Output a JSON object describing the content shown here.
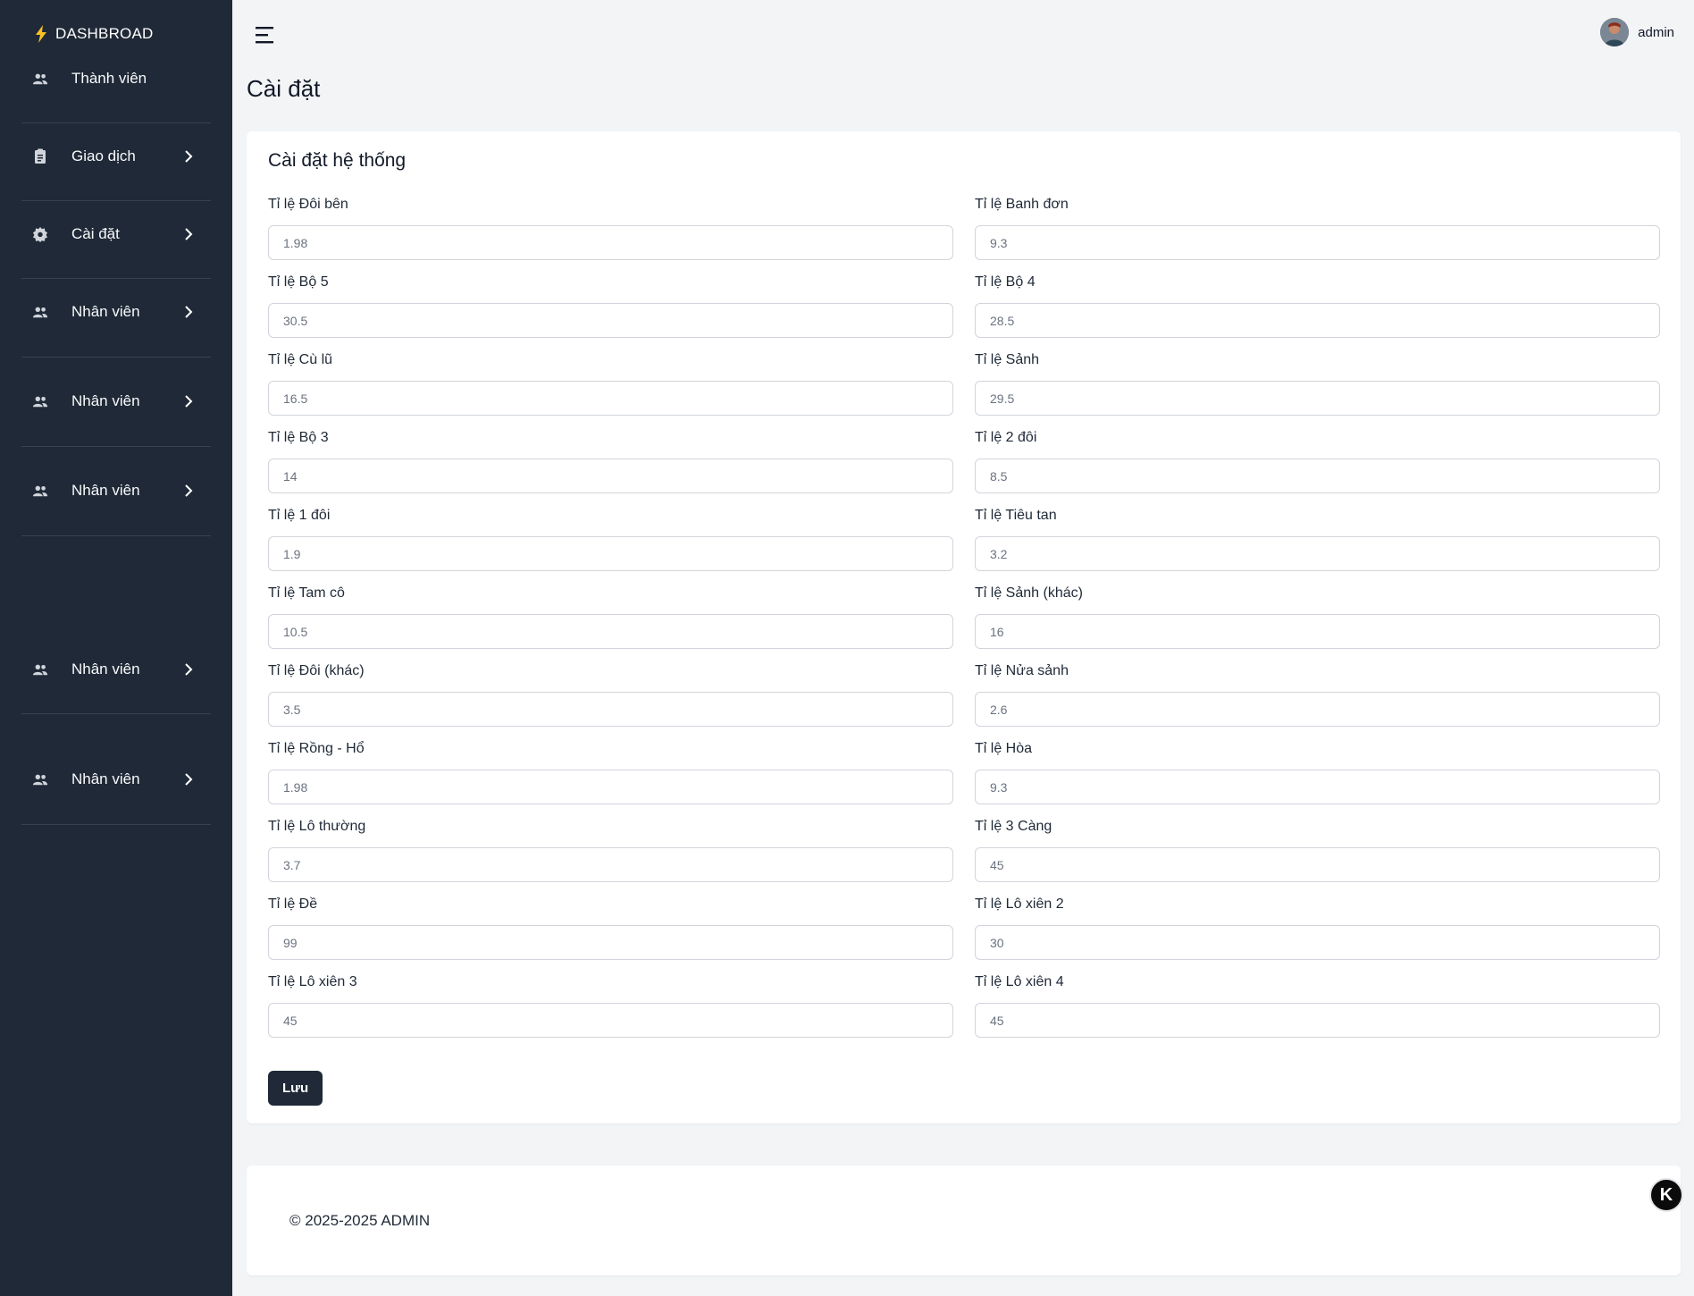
{
  "sidebar": {
    "brand": "DASHBROAD",
    "items": [
      {
        "label": "Thành viên",
        "icon": "users-icon",
        "chevron": false
      },
      {
        "label": "Giao dịch",
        "icon": "clipboard-icon",
        "chevron": true
      },
      {
        "label": "Cài đặt",
        "icon": "gear-icon",
        "chevron": true
      },
      {
        "label": "Nhân viên",
        "icon": "users-icon",
        "chevron": true
      },
      {
        "label": "Nhân viên",
        "icon": "users-icon",
        "chevron": true
      },
      {
        "label": "Nhân viên",
        "icon": "users-icon",
        "chevron": true
      },
      {
        "label": "Nhân viên",
        "icon": "users-icon",
        "chevron": true
      },
      {
        "label": "Nhân viên",
        "icon": "users-icon",
        "chevron": true
      }
    ]
  },
  "header": {
    "user_name": "admin"
  },
  "page_title": "Cài đặt",
  "form": {
    "title": "Cài đặt hệ thống",
    "fields": [
      {
        "label": "Tỉ lệ Đôi bên",
        "value": "1.98"
      },
      {
        "label": "Tỉ lệ Banh đơn",
        "value": "9.3"
      },
      {
        "label": "Tỉ lệ Bộ 5",
        "value": "30.5"
      },
      {
        "label": "Tỉ lệ Bộ 4",
        "value": "28.5"
      },
      {
        "label": "Tỉ lệ Cù lũ",
        "value": "16.5"
      },
      {
        "label": "Tỉ lệ Sảnh",
        "value": "29.5"
      },
      {
        "label": "Tỉ lệ Bộ 3",
        "value": "14"
      },
      {
        "label": "Tỉ lệ 2 đôi",
        "value": "8.5"
      },
      {
        "label": "Tỉ lệ 1 đôi",
        "value": "1.9"
      },
      {
        "label": "Tỉ lệ Tiêu tan",
        "value": "3.2"
      },
      {
        "label": "Tỉ lệ Tam cô",
        "value": "10.5"
      },
      {
        "label": "Tỉ lệ Sảnh (khác)",
        "value": "16"
      },
      {
        "label": "Tỉ lệ Đôi (khác)",
        "value": "3.5"
      },
      {
        "label": "Tỉ lệ Nửa sảnh",
        "value": "2.6"
      },
      {
        "label": "Tỉ lệ Rồng - Hổ",
        "value": "1.98"
      },
      {
        "label": "Tỉ lệ Hòa",
        "value": "9.3"
      },
      {
        "label": "Tỉ lệ Lô thường",
        "value": "3.7"
      },
      {
        "label": "Tỉ lệ 3 Càng",
        "value": "45"
      },
      {
        "label": "Tỉ lệ Đề",
        "value": "99"
      },
      {
        "label": "Tỉ lệ Lô xiên 2",
        "value": "30"
      },
      {
        "label": "Tỉ lệ Lô xiên 3",
        "value": "45"
      },
      {
        "label": "Tỉ lệ Lô xiên 4",
        "value": "45"
      }
    ],
    "save_label": "Lưu"
  },
  "footer": {
    "text": "© 2025-2025 ADMIN"
  },
  "help_fab": {
    "label": "K",
    "icon": "help-chat-icon"
  },
  "colors": {
    "sidebar_bg": "#1f2937",
    "page_bg": "#f3f4f6",
    "accent": "#1f2937",
    "brand_icon": "#fbbf24"
  }
}
